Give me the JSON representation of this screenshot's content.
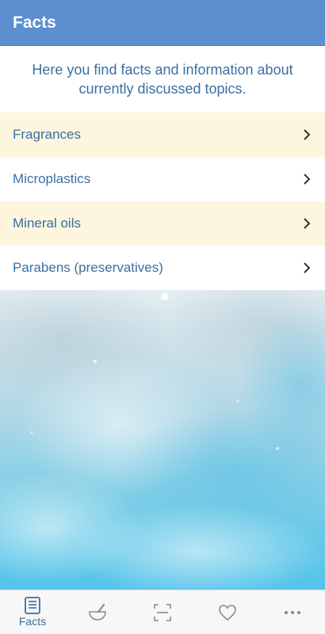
{
  "header": {
    "title": "Facts"
  },
  "intro": {
    "text": "Here you find facts and information about currently discussed topics."
  },
  "topics": [
    {
      "label": "Fragrances"
    },
    {
      "label": "Microplastics"
    },
    {
      "label": "Mineral oils"
    },
    {
      "label": "Parabens (preservatives)"
    }
  ],
  "bottom_nav": [
    {
      "label": "Facts",
      "icon": "facts-icon",
      "active": true
    },
    {
      "label": "",
      "icon": "mortar-pestle-icon",
      "active": false
    },
    {
      "label": "",
      "icon": "scan-icon",
      "active": false
    },
    {
      "label": "",
      "icon": "heart-icon",
      "active": false
    },
    {
      "label": "",
      "icon": "more-icon",
      "active": false
    }
  ],
  "colors": {
    "app_bar": "#5b8fd0",
    "accent_text": "#3b6fa3",
    "row_alt": "#fdf5dd",
    "nav_active": "#3b6fa3",
    "nav_inactive": "#8a8a8a"
  }
}
